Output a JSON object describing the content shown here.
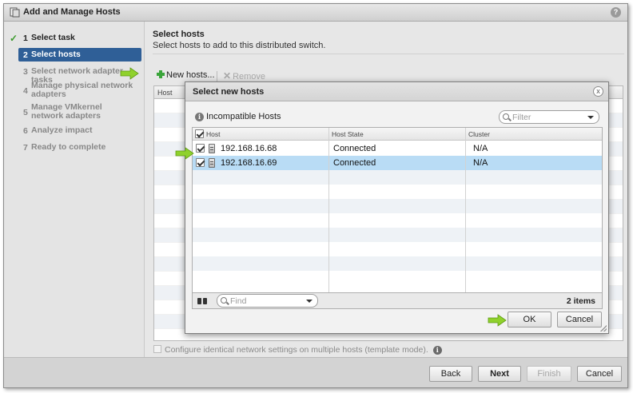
{
  "window": {
    "title": "Add and Manage Hosts",
    "help_glyph": "?"
  },
  "steps": [
    {
      "num": "1",
      "label": "Select task",
      "state": "done"
    },
    {
      "num": "2",
      "label": "Select hosts",
      "state": "active"
    },
    {
      "num": "3",
      "label": "Select network adapter tasks",
      "state": "pending"
    },
    {
      "num": "4",
      "label": "Manage physical network adapters",
      "state": "pending"
    },
    {
      "num": "5",
      "label": "Manage VMkernel network adapters",
      "state": "pending"
    },
    {
      "num": "6",
      "label": "Analyze impact",
      "state": "pending"
    },
    {
      "num": "7",
      "label": "Ready to complete",
      "state": "pending"
    }
  ],
  "content": {
    "heading": "Select hosts",
    "subheading": "Select hosts to add to this distributed switch.",
    "toolbar": {
      "new_hosts": "New hosts...",
      "remove": "Remove"
    },
    "table_header": "Host",
    "template_option": "Configure identical network settings on multiple hosts (template mode).",
    "info_glyph": "i"
  },
  "footer": {
    "back": "Back",
    "next": "Next",
    "finish": "Finish",
    "cancel": "Cancel"
  },
  "dialog": {
    "title": "Select new hosts",
    "close_glyph": "x",
    "incompatible_link": "Incompatible Hosts",
    "filter_placeholder": "Filter",
    "columns": [
      "Host",
      "Host State",
      "Cluster"
    ],
    "rows": [
      {
        "host": "192.168.16.68",
        "state": "Connected",
        "cluster": "N/A",
        "checked": true,
        "selected": false
      },
      {
        "host": "192.168.16.69",
        "state": "Connected",
        "cluster": "N/A",
        "checked": true,
        "selected": true
      }
    ],
    "find_placeholder": "Find",
    "item_count": "2 items",
    "ok": "OK",
    "cancel": "Cancel"
  },
  "colors": {
    "accent": "#2f5f97",
    "selection": "#b9dcf5",
    "arrow": "#8fd12c",
    "check": "#3a9a2a"
  }
}
